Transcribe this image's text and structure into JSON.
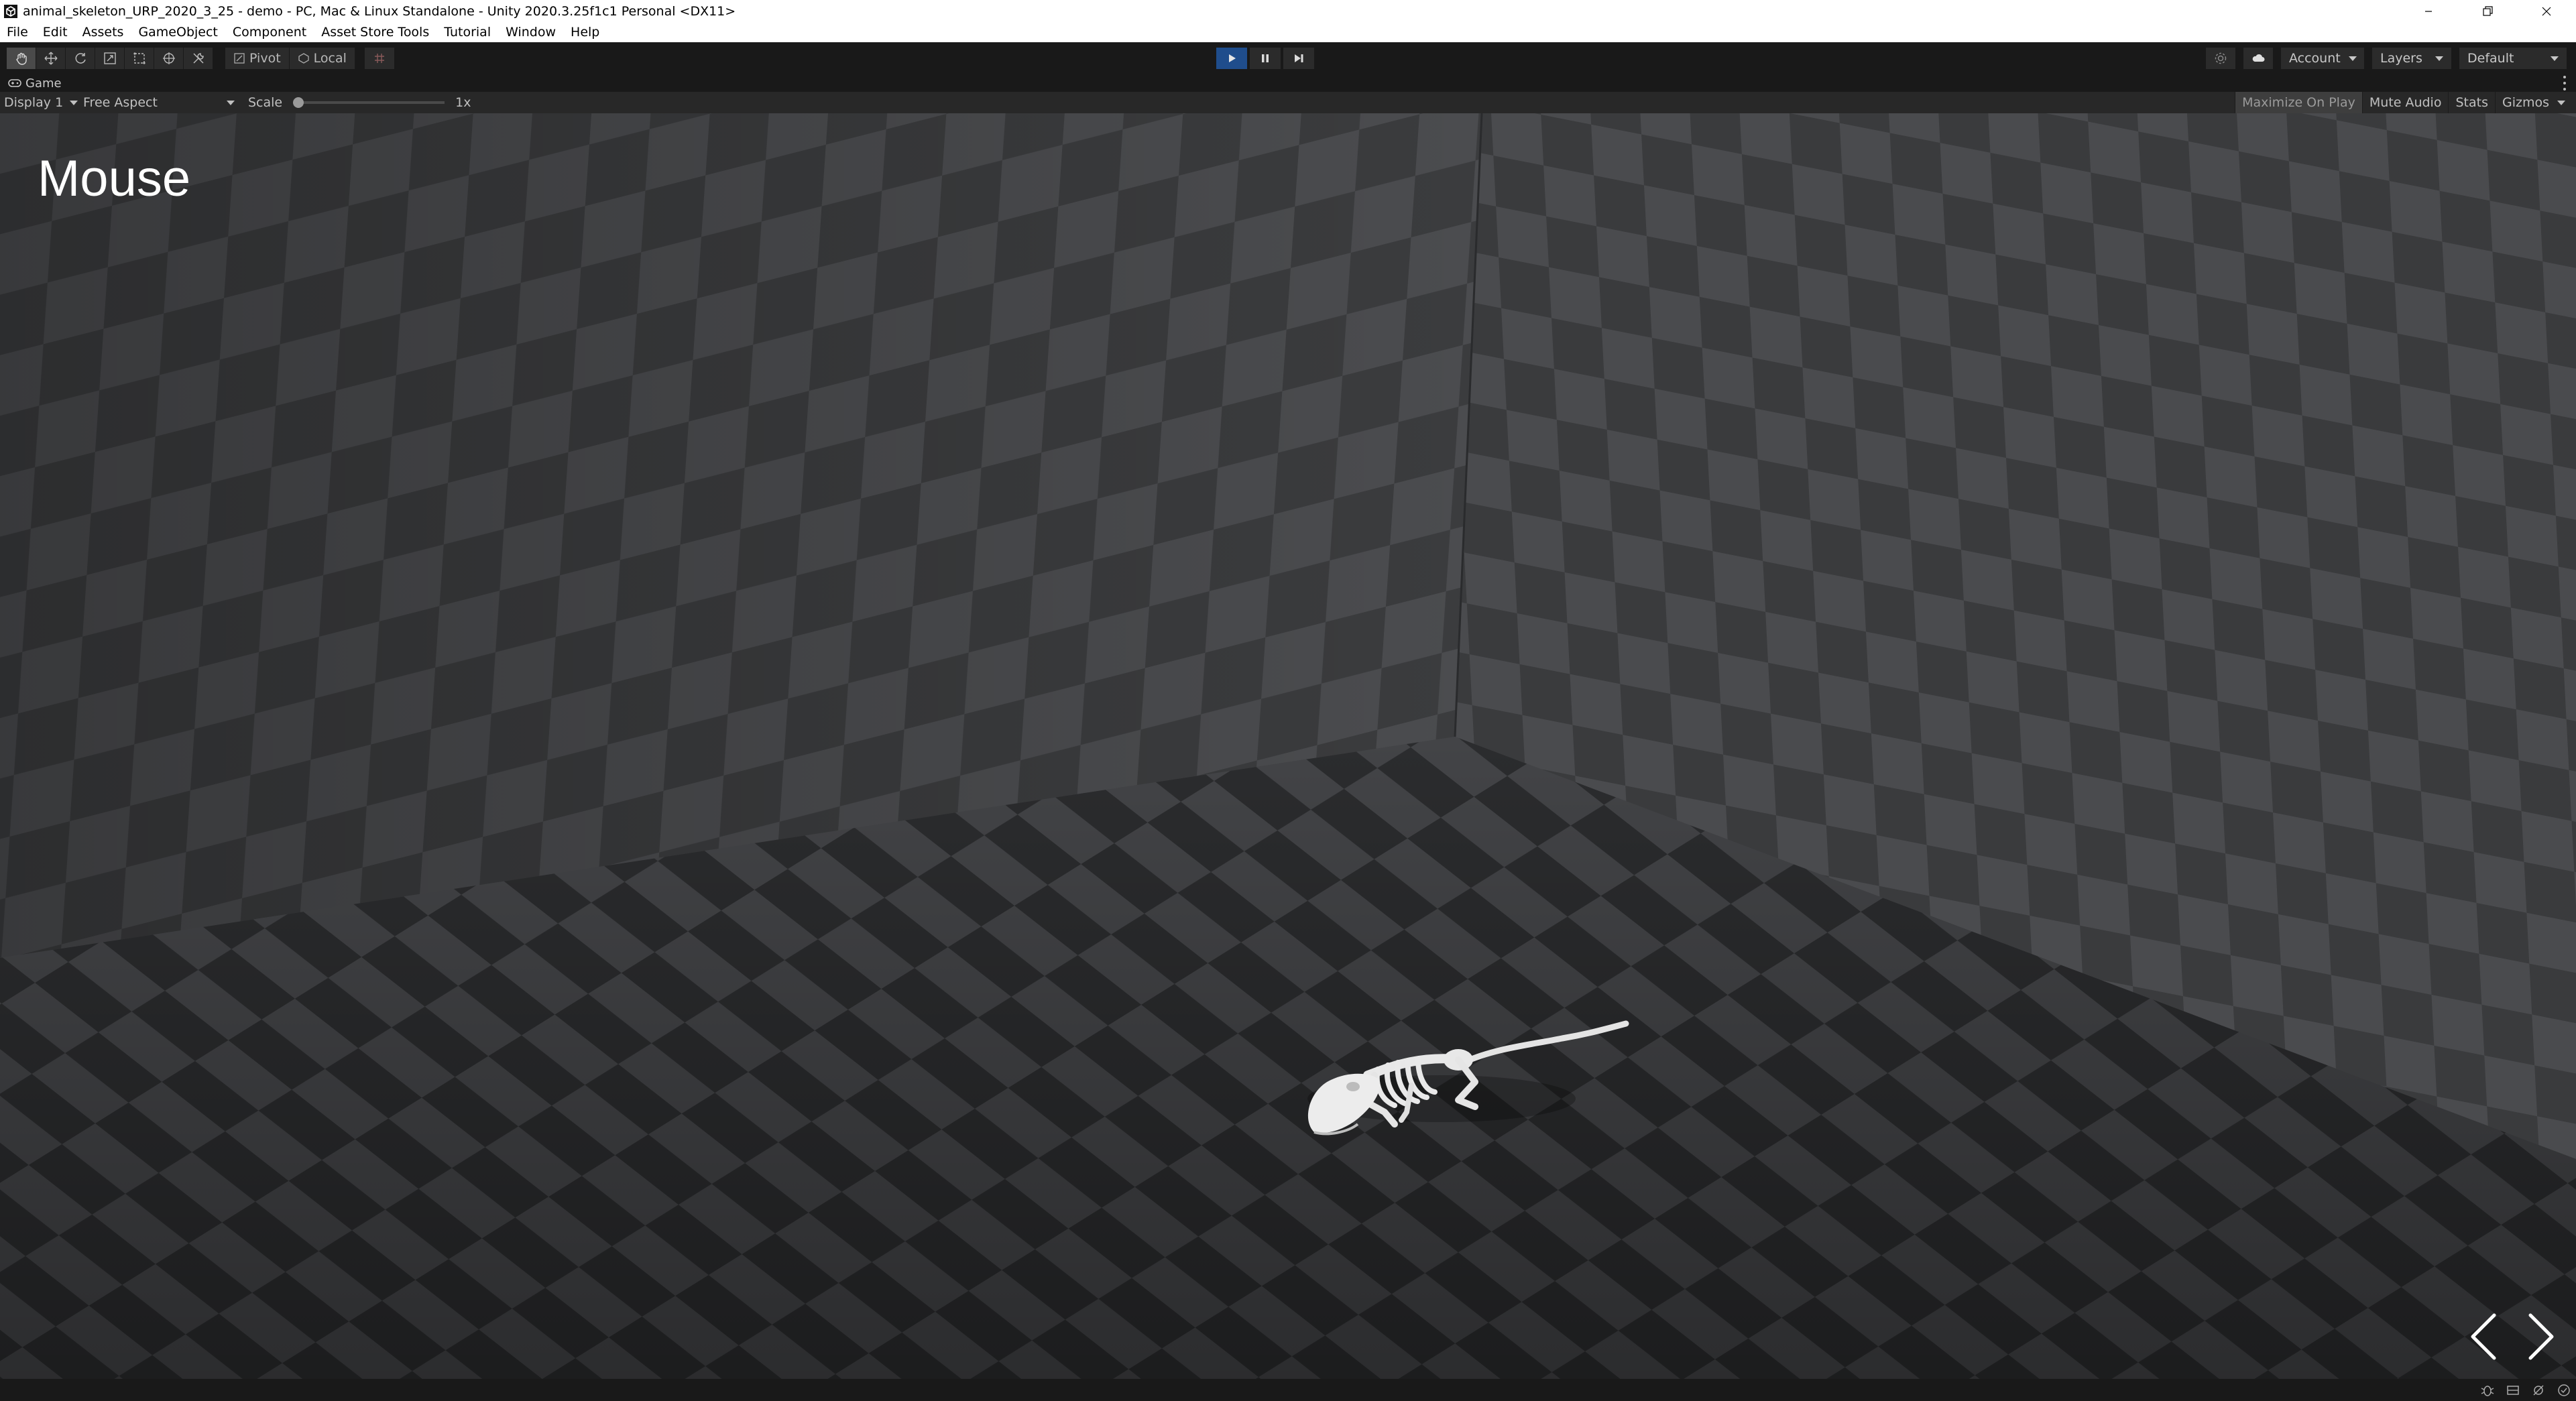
{
  "window": {
    "title": "animal_skeleton_URP_2020_3_25 - demo - PC, Mac & Linux Standalone - Unity 2020.3.25f1c1 Personal <DX11>"
  },
  "menu": [
    "File",
    "Edit",
    "Assets",
    "GameObject",
    "Component",
    "Asset Store Tools",
    "Tutorial",
    "Window",
    "Help"
  ],
  "toolbar": {
    "tools": [
      "hand-tool",
      "move-tool",
      "rotate-tool",
      "scale-tool",
      "rect-tool",
      "transform-tool",
      "custom-tool"
    ],
    "pivot_label": "Pivot",
    "local_label": "Local",
    "account_label": "Account",
    "layers_label": "Layers",
    "layout_label": "Default",
    "play_state": "playing"
  },
  "game_tab": {
    "label": "Game"
  },
  "game_controls": {
    "display": "Display 1",
    "aspect": "Free Aspect",
    "scale_label": "Scale",
    "scale_value": "1x",
    "maximize": "Maximize On Play",
    "mute": "Mute Audio",
    "stats": "Stats",
    "gizmos": "Gizmos"
  },
  "scene": {
    "title": "Mouse"
  },
  "colors": {
    "play_active": "#1f4d8c",
    "toolbar_bg": "#191919",
    "viewport_light_tile": "#4a4b4e",
    "viewport_dark_tile": "#2e2f31",
    "skeleton_bone": "#e8e8e8"
  }
}
